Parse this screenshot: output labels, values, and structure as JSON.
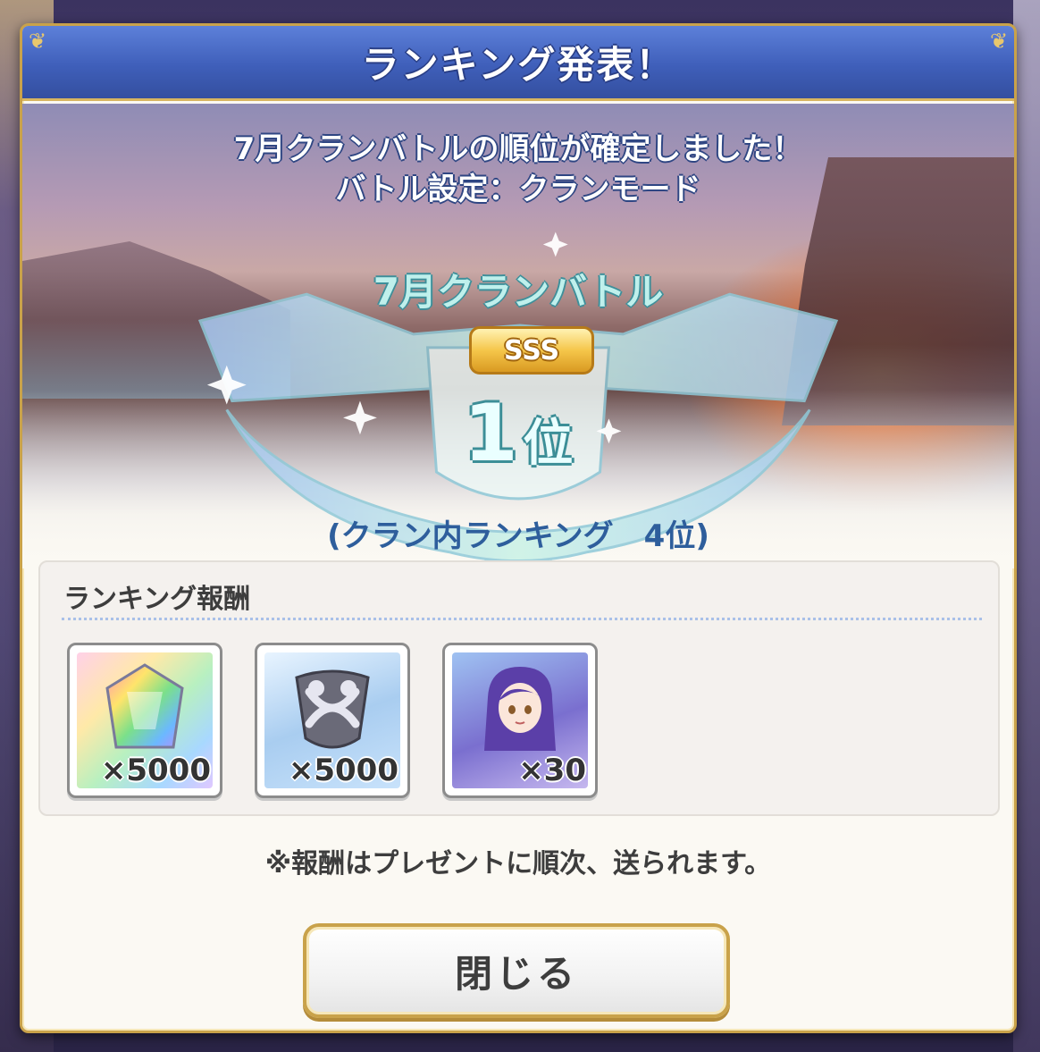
{
  "dialog": {
    "title": "ランキング発表！"
  },
  "result": {
    "message_line1": "7月クランバトルの順位が確定しました！",
    "message_line2": "バトル設定：クランモード",
    "clan_battle_name": "7月クランバトル",
    "rank_grade": "SSS",
    "rank_number": "1",
    "rank_unit": "位",
    "in_clan_ranking": "(クラン内ランキング　4位)"
  },
  "rewards": {
    "heading": "ランキング報酬",
    "items": [
      {
        "icon": "rainbow-crystal-icon",
        "quantity": "×5000"
      },
      {
        "icon": "clan-coin-icon",
        "quantity": "×5000"
      },
      {
        "icon": "character-memory-piece-icon",
        "quantity": "×30"
      }
    ],
    "notice": "※報酬はプレゼントに順次、送られます。"
  },
  "buttons": {
    "close_label": "閉じる"
  },
  "colors": {
    "title_bar": "#3f5fba",
    "frame_gold": "#c9a24a",
    "rank_teal": "#3c8e97",
    "badge_gold": "#f5c64a"
  }
}
